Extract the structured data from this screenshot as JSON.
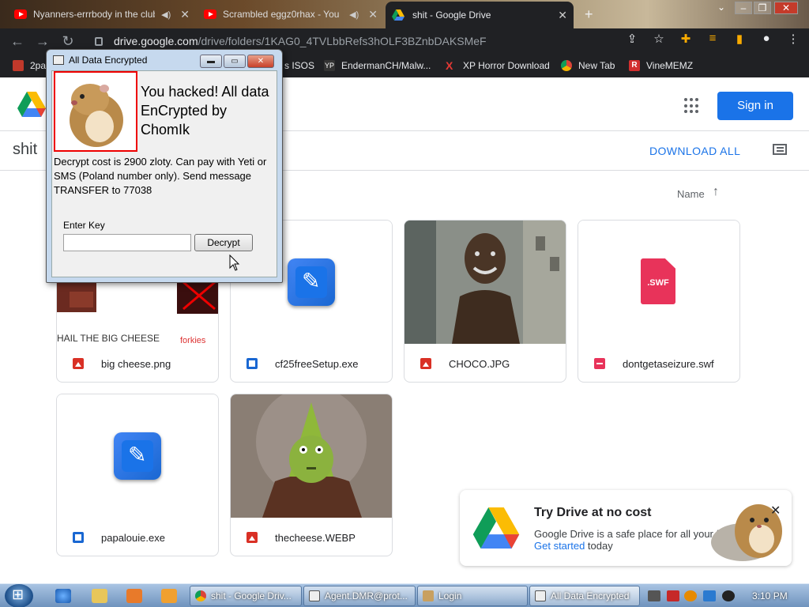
{
  "browser": {
    "tabs": [
      {
        "title": "Nyanners-errrbody in the club",
        "icon": "youtube-icon",
        "muted": true,
        "active": false
      },
      {
        "title": "Scrambled eggz0rhax - You",
        "icon": "youtube-icon",
        "muted": true,
        "active": false
      },
      {
        "title": "shit - Google Drive",
        "icon": "google-drive-icon",
        "muted": false,
        "active": true
      }
    ],
    "new_tab_symbol": "+",
    "url_host": "drive.google.com",
    "url_path": "/drive/folders/1KAG0_4TVLbbRefs3hOLF3BZnbDAKSMeF",
    "bookmarks": [
      {
        "label": "2pa",
        "icon": "bookmark-icon",
        "color": "#c0392b"
      },
      {
        "label": "s ISOS",
        "icon": "bookmark-icon",
        "color": "#555555"
      },
      {
        "label": "EndermanCH/Malw...",
        "icon": "yp-icon",
        "color": "#333333"
      },
      {
        "label": "XP Horror Download",
        "icon": "x-icon",
        "color": "#e53935"
      },
      {
        "label": "New Tab",
        "icon": "chrome-icon",
        "color": "#888888"
      },
      {
        "label": "VineMEMZ",
        "icon": "vine-icon",
        "color": "#d32f2f"
      }
    ]
  },
  "drive": {
    "sign_in_label": "Sign in",
    "folder_title": "shit",
    "download_all_label": "DOWNLOAD ALL",
    "sort_label": "Name",
    "sort_arrow": "↑",
    "files": [
      {
        "name": "big cheese.png",
        "type": "image",
        "caption": "HAIL THE BIG CHEESE",
        "caption2": "forkies"
      },
      {
        "name": "cf25freeSetup.exe",
        "type": "exe"
      },
      {
        "name": "CHOCO.JPG",
        "type": "image"
      },
      {
        "name": "dontgetaseizure.swf",
        "type": "swf",
        "badge": ".SWF"
      },
      {
        "name": "papalouie.exe",
        "type": "exe"
      },
      {
        "name": "thecheese.WEBP",
        "type": "image"
      }
    ],
    "promo": {
      "title": "Try Drive at no cost",
      "body": "Google Drive is a safe place for all your f",
      "link": "Get started",
      "link_suffix": " today",
      "close": "✕"
    }
  },
  "dialog": {
    "title": "All Data Encrypted",
    "headline": "You hacked! All data EnCrypted by ChomIk",
    "message": "Decrypt cost is 2900 zloty. Can pay with Yeti or SMS (Poland number only). Send message TRANSFER to 77038",
    "key_label": "Enter Key",
    "key_value": "",
    "decrypt_label": "Decrypt",
    "close_label": "✕"
  },
  "taskbar": {
    "tasks": [
      {
        "label": "shit - Google Driv...",
        "icon": "chrome-icon",
        "active": false
      },
      {
        "label": "Agent.DMR@prot...",
        "icon": "window-icon",
        "active": false
      },
      {
        "label": "Login",
        "icon": "login-icon",
        "active": false
      },
      {
        "label": "All Data Encrypted",
        "icon": "window-icon",
        "active": true
      }
    ],
    "clock": "3:10 PM"
  }
}
